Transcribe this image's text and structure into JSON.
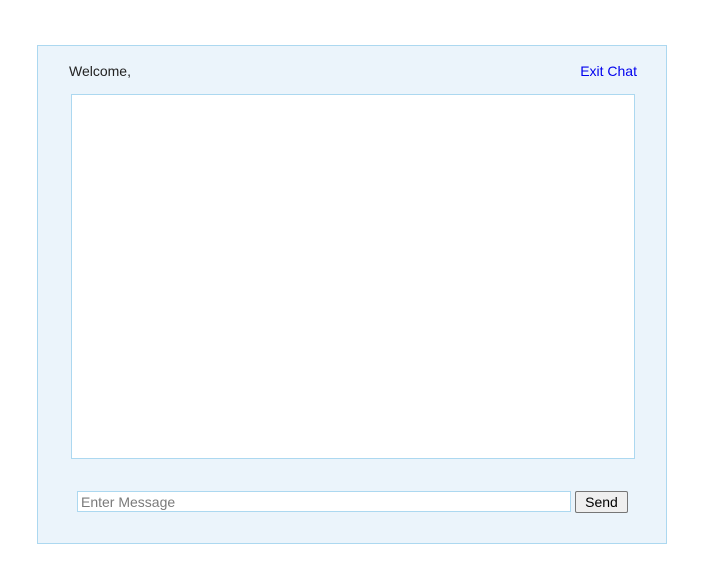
{
  "menu": {
    "welcome_text": "Welcome,",
    "exit_label": "Exit Chat"
  },
  "chatbox": {
    "messages": []
  },
  "message_form": {
    "input_value": "",
    "input_placeholder": "Enter Message",
    "send_label": "Send"
  },
  "colors": {
    "panel_background": "#ebf4fb",
    "panel_border": "#acd8f0",
    "link": "#0000ee"
  }
}
